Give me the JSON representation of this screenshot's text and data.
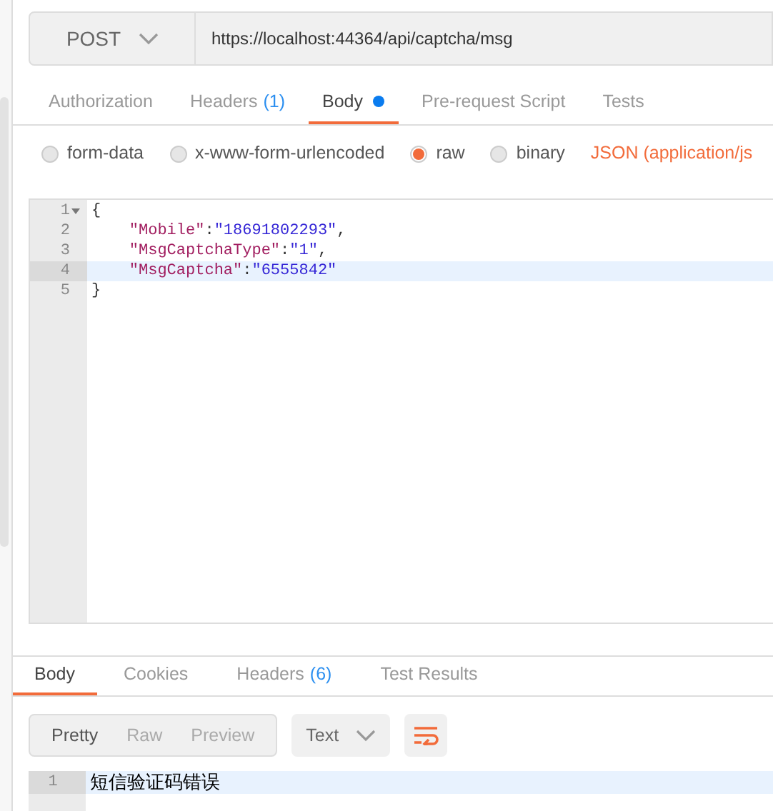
{
  "request": {
    "method": "POST",
    "url": "https://localhost:44364/api/captcha/msg"
  },
  "request_tabs": [
    {
      "label": "Authorization",
      "selected": false
    },
    {
      "label": "Headers",
      "count": "(1)",
      "selected": false
    },
    {
      "label": "Body",
      "selected": true,
      "modified": true
    },
    {
      "label": "Pre-request Script",
      "selected": false
    },
    {
      "label": "Tests",
      "selected": false
    }
  ],
  "body_types": [
    {
      "label": "form-data",
      "selected": false
    },
    {
      "label": "x-www-form-urlencoded",
      "selected": false
    },
    {
      "label": "raw",
      "selected": true
    },
    {
      "label": "binary",
      "selected": false
    }
  ],
  "content_type": "JSON (application/js",
  "editor_lines": [
    {
      "number": "1",
      "fold": true,
      "highlighted": false,
      "tokens": [
        {
          "kind": "punct",
          "text": "{"
        }
      ]
    },
    {
      "number": "2",
      "fold": false,
      "highlighted": false,
      "tokens": [
        {
          "kind": "key",
          "text": "    \"Mobile\""
        },
        {
          "kind": "punct",
          "text": ":"
        },
        {
          "kind": "string",
          "text": "\"18691802293\""
        },
        {
          "kind": "punct",
          "text": ","
        }
      ]
    },
    {
      "number": "3",
      "fold": false,
      "highlighted": false,
      "tokens": [
        {
          "kind": "key",
          "text": "    \"MsgCaptchaType\""
        },
        {
          "kind": "punct",
          "text": ":"
        },
        {
          "kind": "string",
          "text": "\"1\""
        },
        {
          "kind": "punct",
          "text": ","
        }
      ]
    },
    {
      "number": "4",
      "fold": false,
      "highlighted": true,
      "tokens": [
        {
          "kind": "key",
          "text": "    \"MsgCaptcha\""
        },
        {
          "kind": "punct",
          "text": ":"
        },
        {
          "kind": "string",
          "text": "\"6555842\""
        }
      ]
    },
    {
      "number": "5",
      "fold": false,
      "highlighted": false,
      "tokens": [
        {
          "kind": "punct",
          "text": "}"
        }
      ]
    }
  ],
  "response_tabs": [
    {
      "label": "Body",
      "selected": true
    },
    {
      "label": "Cookies",
      "selected": false
    },
    {
      "label": "Headers",
      "count": "(6)",
      "selected": false
    },
    {
      "label": "Test Results",
      "selected": false
    }
  ],
  "view_modes": [
    {
      "label": "Pretty",
      "selected": true
    },
    {
      "label": "Raw",
      "selected": false
    },
    {
      "label": "Preview",
      "selected": false
    }
  ],
  "format": "Text",
  "wrap_lines": true,
  "response_lines": [
    {
      "number": "1",
      "text": "短信验证码错误",
      "highlighted": true
    }
  ]
}
